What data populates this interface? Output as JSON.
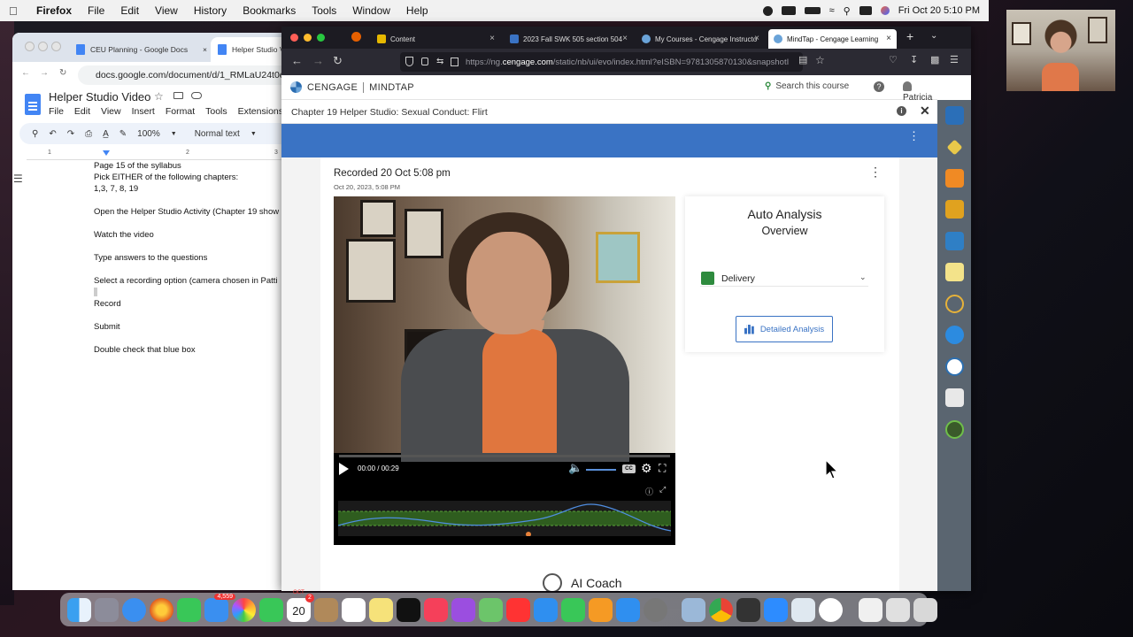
{
  "menubar": {
    "app": "Firefox",
    "items": [
      "File",
      "Edit",
      "View",
      "History",
      "Bookmarks",
      "Tools",
      "Window",
      "Help"
    ],
    "clock": "Fri Oct 20  5:10 PM"
  },
  "gdocs": {
    "tabs": [
      {
        "label": "CEU Planning - Google Docs"
      },
      {
        "label": "Helper Studio V"
      }
    ],
    "url": "docs.google.com/document/d/1_RMLaU24t0e76",
    "doc_title": "Helper Studio Video",
    "menu": [
      "File",
      "Edit",
      "View",
      "Insert",
      "Format",
      "Tools",
      "Extensions",
      "Zo"
    ],
    "zoom": "100%",
    "style": "Normal text",
    "ruler": [
      "1",
      "2",
      "3"
    ],
    "lines": [
      "Page 15 of the syllabus",
      "Pick EITHER of the following chapters:",
      "1,3, 7, 8, 19",
      "Open the Helper Studio Activity (Chapter 19 show",
      "Watch the video",
      "Type answers to the questions",
      "Select a recording option (camera chosen in Patti",
      "Record",
      "Submit",
      "Double check that blue box"
    ]
  },
  "firefox": {
    "tabs": [
      {
        "label": "Content"
      },
      {
        "label": "2023 Fall SWK 505 section 504"
      },
      {
        "label": "My Courses - Cengage Instructo"
      },
      {
        "label": "MindTap - Cengage Learning"
      }
    ],
    "url_prefix": "https://ng.",
    "url_host": "cengage.com",
    "url_rest": "/static/nb/ui/evo/index.html?eISBN=9781305870130&snapshotI"
  },
  "cengage": {
    "brand": "CENGAGE",
    "product": "MINDTAP",
    "search_label": "Search this course",
    "user": "Patricia",
    "activity_title": "Chapter 19 Helper Studio: Sexual Conduct: Flirt",
    "recorded_title": "Recorded 20 Oct 5:08 pm",
    "recorded_sub": "Oct 20, 2023, 5:08 PM",
    "video": {
      "time": "00:00 / 00:29",
      "cc": "CC"
    },
    "analysis": {
      "title": "Auto Analysis",
      "subtitle": "Overview",
      "delivery_label": "Delivery",
      "delivery_color": "#2e8b3e",
      "button_label": "Detailed Analysis"
    },
    "ai_coach": "AI Coach",
    "accent": "#3a73c4"
  },
  "dock": {
    "calendar_day": "20",
    "calendar_month": "OCT",
    "mail_badge": "4,559",
    "cal_badge": "2"
  }
}
